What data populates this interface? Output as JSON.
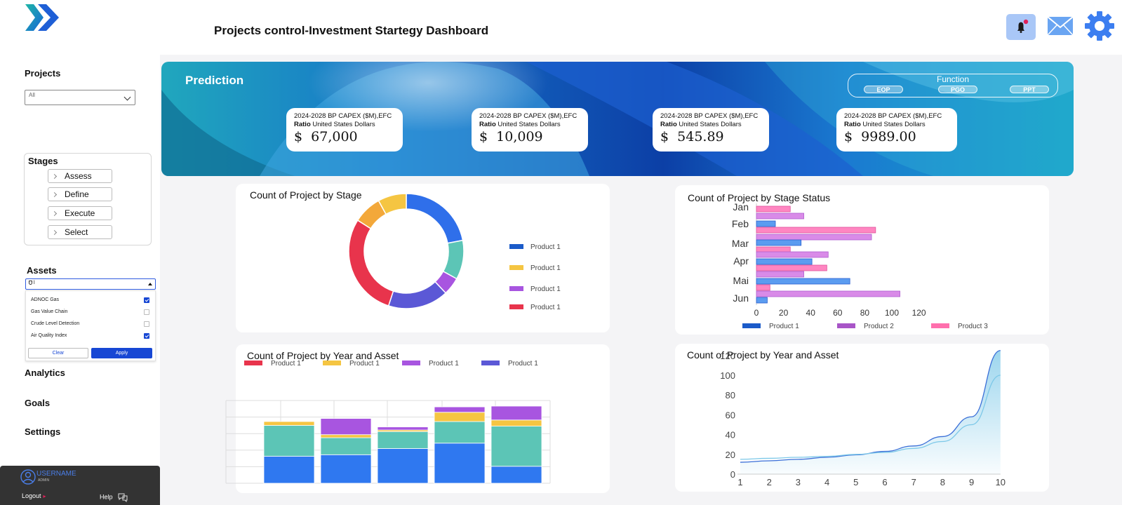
{
  "header": {
    "title": "Projects control-Investment Startegy Dashboard",
    "icons": [
      "logo-icon",
      "bell-icon",
      "mail-icon",
      "gear-icon"
    ],
    "notification_dot_color": "#e0205a",
    "accent": "#3c7ef0"
  },
  "sidebar": {
    "projects": {
      "label": "Projects",
      "selected": "All"
    },
    "stages": {
      "label": "Stages",
      "items": [
        "Assess",
        "Define",
        "Execute",
        "Select"
      ]
    },
    "assets": {
      "label": "Assets",
      "input_value": "l",
      "options": [
        {
          "label": "ADNOC Gas",
          "checked": true
        },
        {
          "label": "Gas Value Chain",
          "checked": false
        },
        {
          "label": "Crude Level Detection",
          "checked": false
        },
        {
          "label": "Air Quality Index",
          "checked": true
        }
      ],
      "clear_label": "Clear",
      "apply_label": "Apply"
    },
    "nav": [
      "Analytics",
      "Goals",
      "Settings"
    ],
    "user": {
      "name": "USERNAME",
      "role": "ADMIN",
      "logout_label": "Logout",
      "help_label": "Help"
    }
  },
  "prediction": {
    "title": "Prediction",
    "function": {
      "label": "Function",
      "options": [
        "EOP",
        "PGO",
        "PPT"
      ]
    },
    "kpis": [
      {
        "line1": "2024-2028 BP CAPEX ($M),EFC",
        "ratio": "Ratio",
        "unit": "United States Dollars",
        "value": "$  67,000"
      },
      {
        "line1": "2024-2028 BP CAPEX ($M),EFC",
        "ratio": "Ratio",
        "unit": "United States Dollars",
        "value": "$  10,009"
      },
      {
        "line1": "2024-2028 BP CAPEX ($M),EFC",
        "ratio": "Ratio",
        "unit": "United States Dollars",
        "value": "$  545.89"
      },
      {
        "line1": "2024-2028 BP CAPEX ($M),EFC",
        "ratio": "Ratio",
        "unit": "United States Dollars",
        "value": "$  9989.00"
      }
    ]
  },
  "chart_data": [
    {
      "type": "pie",
      "title": "Count of Project by Stage",
      "slices": [
        {
          "value": 22,
          "color": "#2f6fea"
        },
        {
          "value": 11,
          "color": "#5cc5b6"
        },
        {
          "value": 5,
          "color": "#a855e0"
        },
        {
          "value": 17,
          "color": "#5b58d6"
        },
        {
          "value": 29,
          "color": "#e8344c"
        },
        {
          "value": 8,
          "color": "#f3a83a"
        },
        {
          "value": 8,
          "color": "#f5c542"
        }
      ],
      "legend": [
        {
          "name": "Product 1",
          "color": "#1b5bc9"
        },
        {
          "name": "Product 1",
          "color": "#f5c542"
        },
        {
          "name": "Product 1",
          "color": "#a855e0"
        },
        {
          "name": "Product 1",
          "color": "#e8344c"
        }
      ]
    },
    {
      "type": "bar",
      "orientation": "horizontal",
      "title": "Count of Project by Stage Status",
      "categories": [
        "Jan",
        "Feb",
        "Mar",
        "Apr",
        "Mai",
        "Jun"
      ],
      "xlim": [
        0,
        120
      ],
      "xticks": [
        0,
        20,
        40,
        60,
        80,
        100,
        120
      ],
      "bars": [
        {
          "cat": "Jan",
          "value": 25,
          "color": "#ff86c1"
        },
        {
          "cat": "Jan",
          "value": 35,
          "color": "#d98be8"
        },
        {
          "cat": "Feb",
          "value": 14,
          "color": "#5b9cf0"
        },
        {
          "cat": "Feb",
          "value": 88,
          "color": "#ff86c1"
        },
        {
          "cat": "Feb",
          "value": 85,
          "color": "#d98be8"
        },
        {
          "cat": "Mar",
          "value": 33,
          "color": "#5b9cf0"
        },
        {
          "cat": "Mar",
          "value": 25,
          "color": "#ff86c1"
        },
        {
          "cat": "Apr",
          "value": 53,
          "color": "#d98be8"
        },
        {
          "cat": "Apr",
          "value": 41,
          "color": "#5b9cf0"
        },
        {
          "cat": "Apr",
          "value": 52,
          "color": "#ff86c1"
        },
        {
          "cat": "Mai",
          "value": 35,
          "color": "#d98be8"
        },
        {
          "cat": "Mai",
          "value": 69,
          "color": "#5b9cf0"
        },
        {
          "cat": "Mai",
          "value": 10,
          "color": "#ff86c1"
        },
        {
          "cat": "Jun",
          "value": 106,
          "color": "#d98be8"
        },
        {
          "cat": "Jun",
          "value": 8,
          "color": "#5b9cf0"
        }
      ],
      "legend": [
        {
          "name": "Product 1",
          "color": "#1b5bc9"
        },
        {
          "name": "Product 2",
          "color": "#a855c7"
        },
        {
          "name": "Product 3",
          "color": "#ff6fad"
        }
      ]
    },
    {
      "type": "bar",
      "stacked": true,
      "title": "Count of Project by Year and Asset",
      "categories": [
        "1",
        "2",
        "3",
        "4",
        "5"
      ],
      "ylim": [
        0,
        100
      ],
      "series": [
        {
          "color": "#2f78f0",
          "values": [
            35,
            37,
            45,
            52,
            22
          ]
        },
        {
          "color": "#5cc5b6",
          "values": [
            40,
            22,
            22,
            28,
            52
          ]
        },
        {
          "color": "#f5c542",
          "values": [
            5,
            4,
            2,
            12,
            8
          ]
        },
        {
          "color": "#a855e0",
          "values": [
            0,
            21,
            4,
            7,
            18
          ]
        }
      ],
      "legend": [
        {
          "name": "Product 1",
          "color": "#e8344c"
        },
        {
          "name": "Product 1",
          "color": "#f5c542"
        },
        {
          "name": "Product 1",
          "color": "#a855e0"
        },
        {
          "name": "Product 1",
          "color": "#5b58d6"
        }
      ]
    },
    {
      "type": "area",
      "title": "Count of Project by Year and Asset",
      "x": [
        1,
        2,
        3,
        4,
        5,
        6,
        7,
        8,
        9,
        10
      ],
      "xticks": [
        1,
        2,
        3,
        4,
        5,
        6,
        7,
        8,
        9,
        10
      ],
      "yticks": [
        0,
        20,
        40,
        60,
        80,
        100,
        120
      ],
      "ylim": [
        0,
        120
      ],
      "series": [
        {
          "color": "#3b6fd8",
          "values": [
            12,
            13.5,
            15,
            17,
            19.5,
            23,
            28.5,
            38,
            58,
            125
          ]
        },
        {
          "color": "#7cc8e8",
          "values": [
            15,
            16,
            17,
            18,
            20,
            22,
            26,
            33,
            50,
            100
          ]
        }
      ]
    }
  ]
}
